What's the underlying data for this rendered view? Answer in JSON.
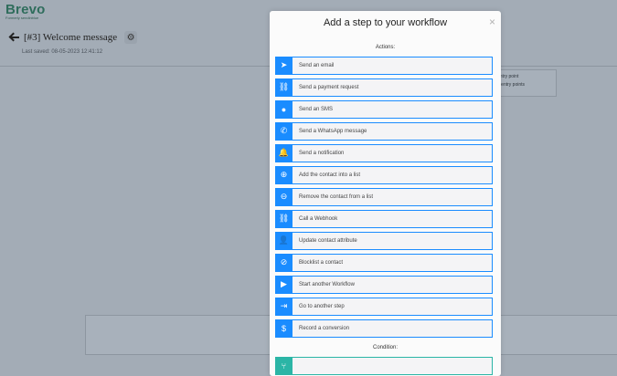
{
  "app": {
    "brand": "Brevo",
    "brand_tagline": "Formerly sendinblue",
    "workflow_title": "[#3] Welcome message",
    "last_saved": "Last saved: 08-05-2023 12:41:12",
    "entry_point_line1": "entry point",
    "entry_point_line2": "e entry points",
    "icons": {
      "back": "back-arrow-icon",
      "settings": "gear-icon"
    }
  },
  "modal": {
    "title": "Add a step to your workflow",
    "close_symbol": "×",
    "actions_label": "Actions:",
    "condition_label": "Condition:",
    "accent_color": "#1a8cff",
    "condition_color": "#2bb5a6",
    "actions": [
      {
        "label": "Send an email",
        "icon": "paper-plane-icon",
        "glyph": "➤"
      },
      {
        "label": "Send a payment request",
        "icon": "link-icon",
        "glyph": "⛓"
      },
      {
        "label": "Send an SMS",
        "icon": "chat-bubble-icon",
        "glyph": "●"
      },
      {
        "label": "Send a WhatsApp message",
        "icon": "whatsapp-icon",
        "glyph": "✆"
      },
      {
        "label": "Send a notification",
        "icon": "bell-icon",
        "glyph": "🔔"
      },
      {
        "label": "Add the contact into a list",
        "icon": "plus-circle-icon",
        "glyph": "⊕"
      },
      {
        "label": "Remove the contact from a list",
        "icon": "minus-circle-icon",
        "glyph": "⊖"
      },
      {
        "label": "Call a Webhook",
        "icon": "link-icon",
        "glyph": "⛓"
      },
      {
        "label": "Update contact attribute",
        "icon": "user-edit-icon",
        "glyph": "👤"
      },
      {
        "label": "Blocklist a contact",
        "icon": "ban-icon",
        "glyph": "⊘"
      },
      {
        "label": "Start another Workflow",
        "icon": "play-icon",
        "glyph": "▶"
      },
      {
        "label": "Go to another step",
        "icon": "sign-in-icon",
        "glyph": "⇥"
      },
      {
        "label": "Record a conversion",
        "icon": "dollar-circle-icon",
        "glyph": "$"
      }
    ],
    "conditions": [
      {
        "label": "",
        "icon": "condition-icon",
        "glyph": "⑂"
      }
    ]
  }
}
